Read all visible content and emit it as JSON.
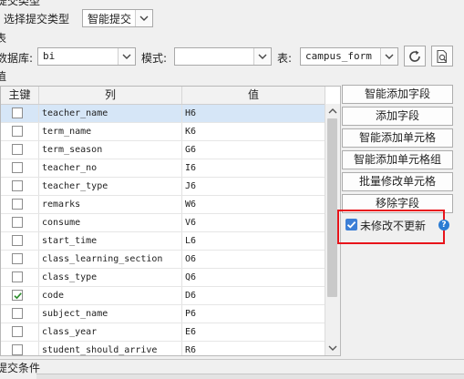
{
  "top": {
    "partial_header": "提交类型",
    "submit_type_label": "选择提交类型",
    "submit_type_value": "智能提交"
  },
  "table_section_label": "表",
  "db_row": {
    "db_label": "数据库:",
    "db_value": "bi",
    "schema_label": "模式:",
    "schema_value": "",
    "table_label": "表:",
    "table_value": "campus_form"
  },
  "value_section_label": "值",
  "grid": {
    "headers": [
      "主键",
      "列",
      "值"
    ],
    "rows": [
      {
        "checked": false,
        "column": "teacher_name",
        "value": "H6"
      },
      {
        "checked": false,
        "column": "term_name",
        "value": "K6"
      },
      {
        "checked": false,
        "column": "term_season",
        "value": "G6"
      },
      {
        "checked": false,
        "column": "teacher_no",
        "value": "I6"
      },
      {
        "checked": false,
        "column": "teacher_type",
        "value": "J6"
      },
      {
        "checked": false,
        "column": "remarks",
        "value": "W6"
      },
      {
        "checked": false,
        "column": "consume",
        "value": "V6"
      },
      {
        "checked": false,
        "column": "start_time",
        "value": "L6"
      },
      {
        "checked": false,
        "column": "class_learning_section",
        "value": "O6"
      },
      {
        "checked": false,
        "column": "class_type",
        "value": "Q6"
      },
      {
        "checked": true,
        "column": "code",
        "value": "D6"
      },
      {
        "checked": false,
        "column": "subject_name",
        "value": "P6"
      },
      {
        "checked": false,
        "column": "class_year",
        "value": "E6"
      },
      {
        "checked": false,
        "column": "student_should_arrive",
        "value": "R6"
      }
    ]
  },
  "actions": {
    "smart_add_field": "智能添加字段",
    "add_field": "添加字段",
    "smart_add_cell": "智能添加单元格",
    "smart_add_cell_group": "智能添加单元格组",
    "batch_edit_cell": "批量修改单元格",
    "remove_field": "移除字段",
    "no_update_if_unchanged": "未修改不更新",
    "no_update_checked": true
  },
  "bottom": {
    "condition_label": "提交条件"
  },
  "colors": {
    "check_blue": "#3d7fd6",
    "check_green": "#2f8f2f",
    "help_blue": "#2b7cd3",
    "highlight_red": "#e8141b"
  }
}
